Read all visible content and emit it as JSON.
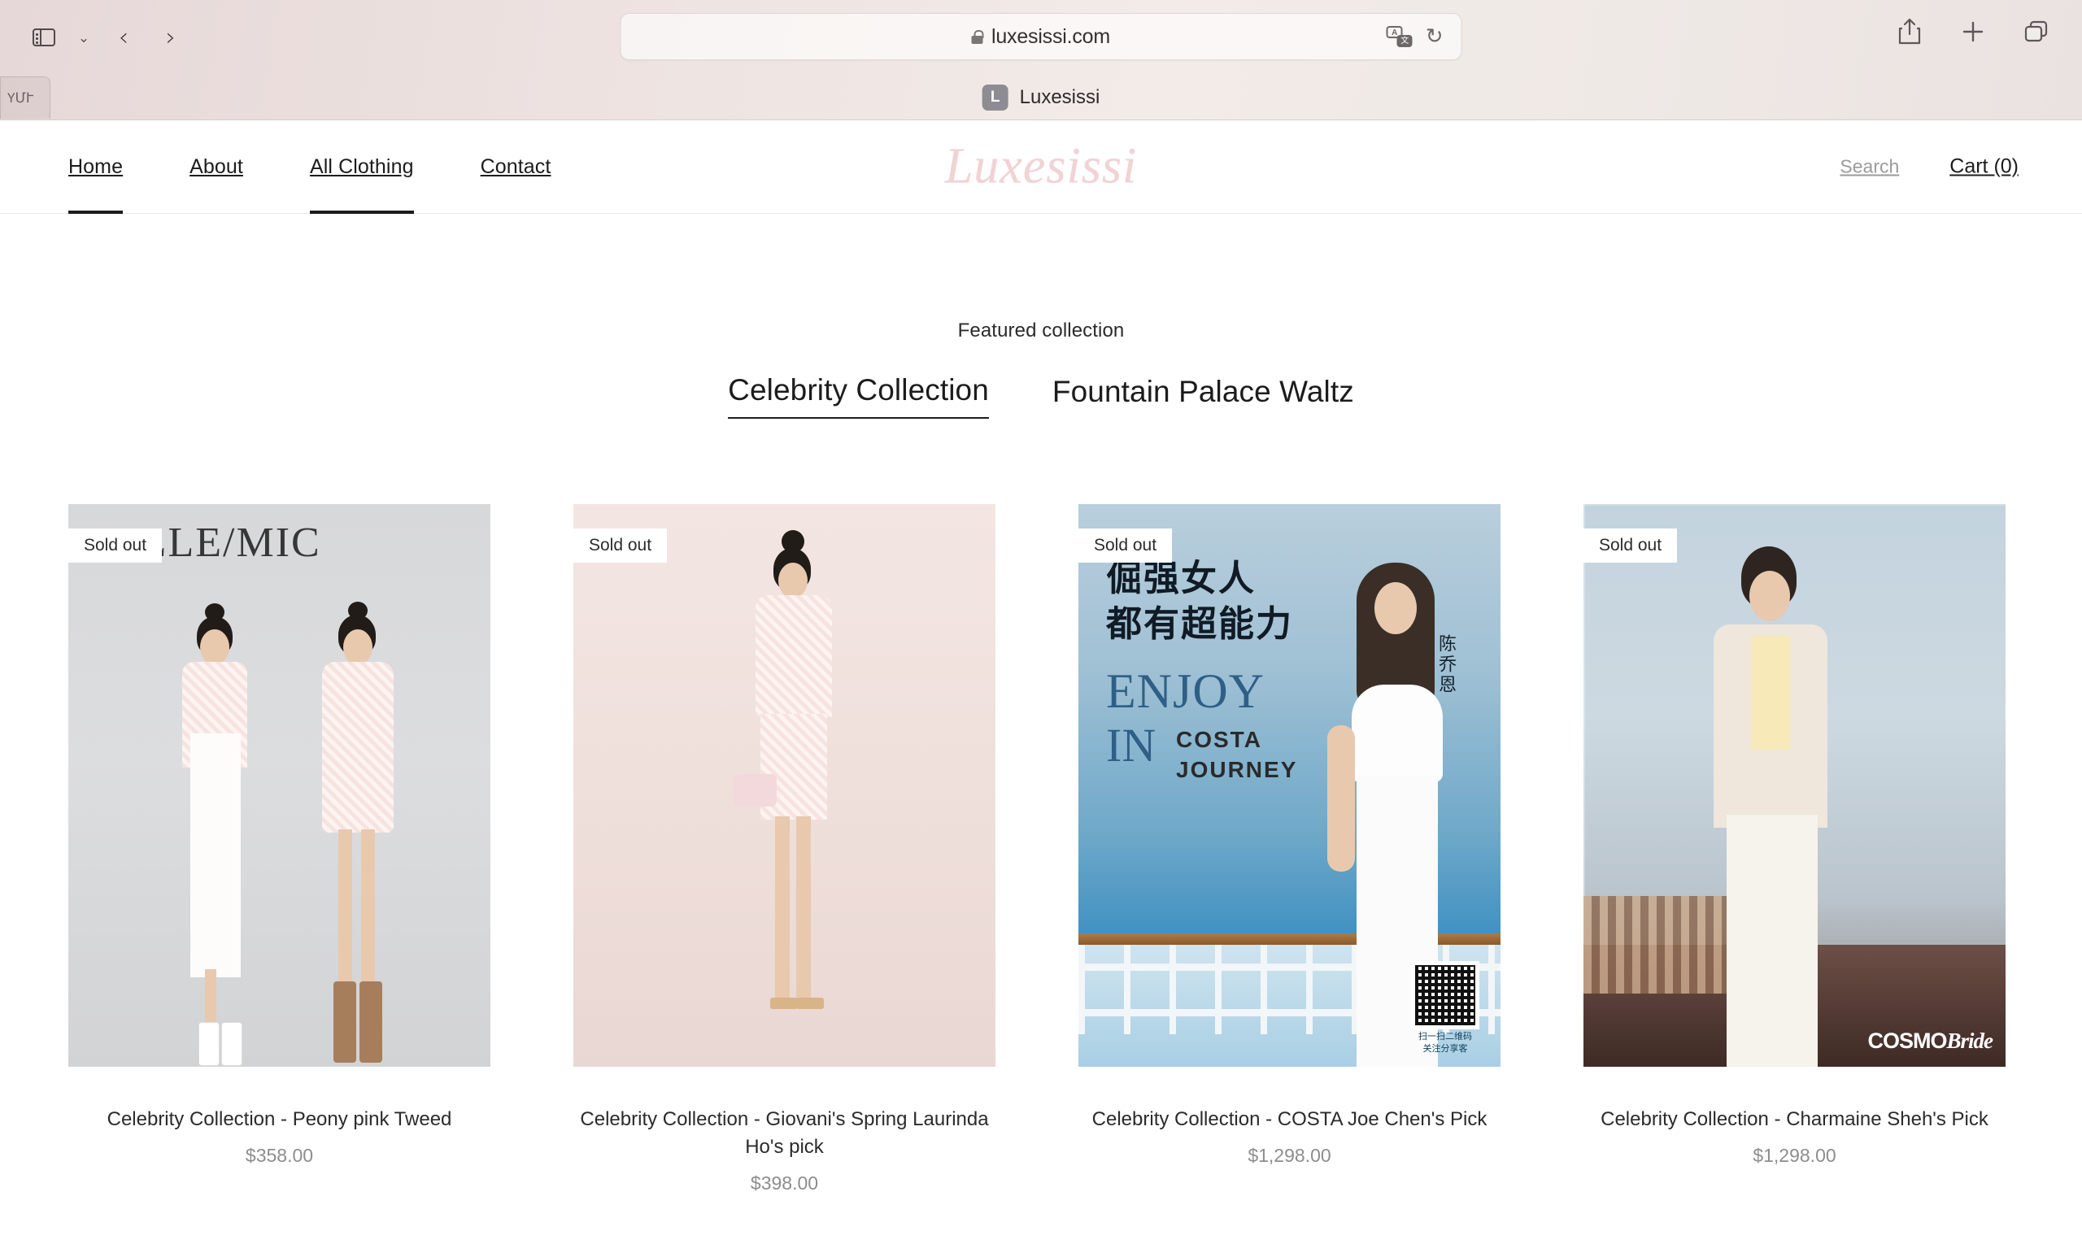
{
  "browser": {
    "toolbar": {
      "sidebar_icon": "sidebar-icon",
      "tab_overview_chevron": "chevron-down-icon",
      "back_label": "‹",
      "forward_label": "›",
      "share_icon": "share-icon",
      "new_tab_icon": "plus-icon",
      "tabs_icon": "tab-overview-icon"
    },
    "address_bar": {
      "url": "luxesissi.com",
      "lock_icon": "lock-icon",
      "translate_icon": "translate-icon",
      "translate_glyph_a": "A",
      "translate_glyph_cjk": "文",
      "reload_icon": "reload-icon",
      "reload_glyph": "↻"
    },
    "tabs": {
      "partial_tab_label": "ҮՄՒ",
      "active_tab": {
        "favicon_letter": "L",
        "title": "Luxesissi"
      }
    }
  },
  "site": {
    "nav": [
      {
        "label": "Home",
        "active": true
      },
      {
        "label": "About",
        "active": false
      },
      {
        "label": "All Clothing",
        "active": true
      },
      {
        "label": "Contact",
        "active": false
      }
    ],
    "brand": "Luxesissi",
    "brand_color": "#f0d3d5",
    "search_label": "Search",
    "cart_label": "Cart (0)"
  },
  "main": {
    "featured_label": "Featured collection",
    "collection_tabs": [
      {
        "label": "Celebrity Collection",
        "active": true
      },
      {
        "label": "Fountain Palace Waltz",
        "active": false
      }
    ],
    "products": [
      {
        "badge": "Sold out",
        "title": "Celebrity Collection - Peony pink Tweed",
        "price": "$358.00",
        "image_alt": "two models in pink tweed and white dress",
        "watermark": "ELLE/MIC"
      },
      {
        "badge": "Sold out",
        "title": "Celebrity Collection - Giovani's Spring Laurinda Ho's pick",
        "price": "$398.00",
        "image_alt": "model in pink houndstooth tweed set with pink bag"
      },
      {
        "badge": "Sold out",
        "title": "Celebrity Collection - COSTA Joe Chen's Pick",
        "price": "$1,298.00",
        "image_alt": "model in white jumpsuit on cruise ship deck",
        "poster": {
          "cn_line1": "倔强女人",
          "cn_line2": "都有超能力",
          "enjoy": "ENJOY",
          "in": "IN",
          "costa_line1": "COSTA",
          "costa_line2": "JOURNEY",
          "celebrity_name": "陈乔恩",
          "qr_caption_line1": "扫一扫二维码",
          "qr_caption_line2": "关注分享客"
        }
      },
      {
        "badge": "Sold out",
        "title": "Celebrity Collection - Charmaine Sheh's Pick",
        "price": "$1,298.00",
        "image_alt": "model in white blazer and jumpsuit by city window",
        "watermark_bold": "COSMO",
        "watermark_italic": "Bride"
      }
    ]
  }
}
